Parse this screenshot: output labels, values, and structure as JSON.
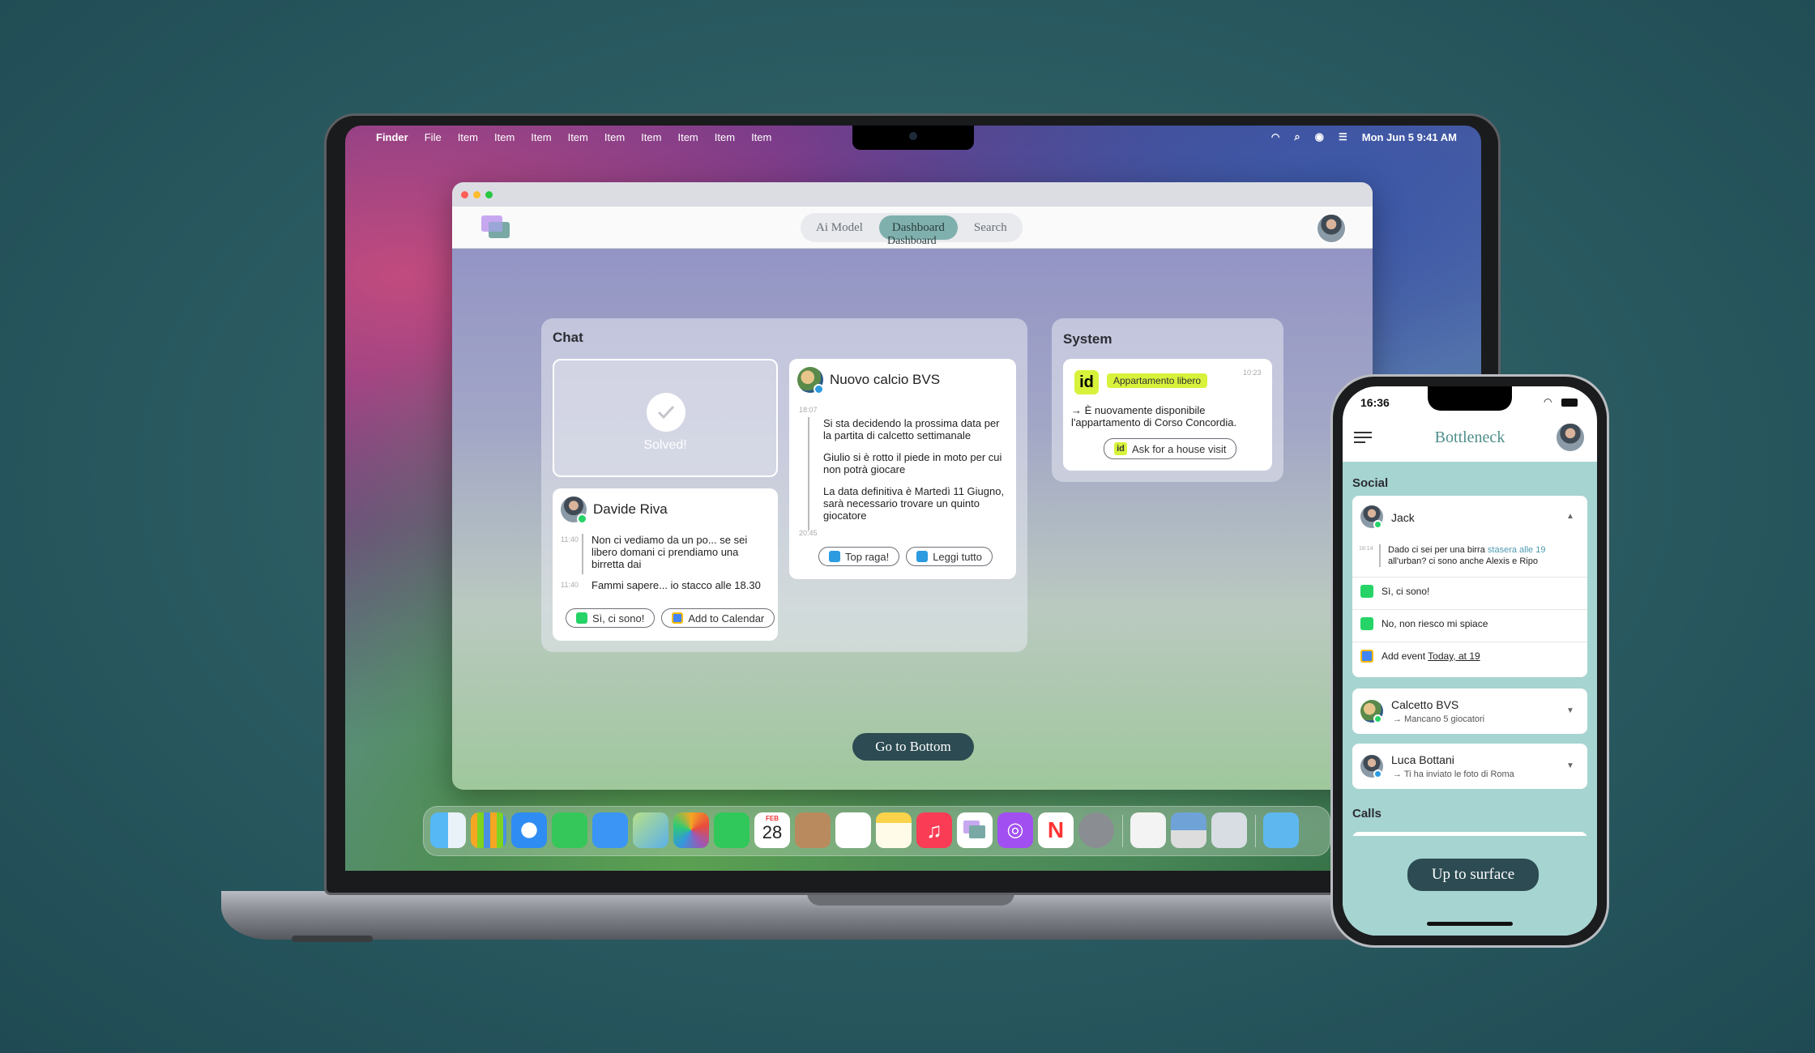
{
  "mac": {
    "menubar": {
      "apple": "",
      "app": "Finder",
      "items": [
        "File",
        "Item",
        "Item",
        "Item",
        "Item",
        "Item",
        "Item",
        "Item",
        "Item",
        "Item"
      ],
      "datetime": "Mon Jun 5  9:41 AM"
    },
    "app": {
      "nav": [
        "Ai Model",
        "Dashboard",
        "Search"
      ],
      "nav_sub": "Dashboard",
      "chat": {
        "title": "Chat",
        "solved": "Solved!",
        "davide": {
          "name": "Davide Riva",
          "m1_time": "11:40",
          "m1": "Non ci vediamo da un po... se sei libero domani ci prendiamo una birretta dai",
          "m2_time": "11:40",
          "m2": "Fammi sapere... io stacco alle 18.30",
          "btn1": "Sì, ci sono!",
          "btn2": "Add to Calendar"
        },
        "nuovo": {
          "name": "Nuovo calcio BVS",
          "t1": "18:07",
          "m1": "Si sta decidendo la prossima data per la partita di calcetto settimanale",
          "m2": "Giulio si è rotto il piede in moto per cui non potrà giocare",
          "m3": "La data definitiva è Martedì 11 Giugno, sarà necessario trovare un quinto giocatore",
          "t2": "20:45",
          "btn1": "Top raga!",
          "btn2": "Leggi tutto"
        }
      },
      "system": {
        "title": "System",
        "logo": "id",
        "tag": "Appartamento libero",
        "time": "10:23",
        "msg": "→ È nuovamente disponibile l'appartamento di Corso Concordia.",
        "btn_icon": "id",
        "btn": "Ask for a house visit"
      },
      "go_bottom": "Go to Bottom"
    },
    "dock": {
      "calendar_month": "FEB",
      "calendar_day": "28"
    }
  },
  "phone": {
    "time": "16:36",
    "title": "Bottleneck",
    "social": "Social",
    "jack": {
      "name": "Jack",
      "time": "18:14",
      "msg_a": "Dado ci sei per una birra ",
      "msg_link": "stasera alle 19",
      "msg_b": " all'urban? ci sono anche Alexis e Ripo",
      "opt1": "Sì, ci sono!",
      "opt2": "No, non riesco mi spiace",
      "opt3_a": "Add event ",
      "opt3_b": "Today, at 19"
    },
    "calcetto": {
      "name": "Calcetto BVS",
      "sub": "→ Mancano 5 giocatori"
    },
    "luca": {
      "name": "Luca Bottani",
      "sub": "→ Ti ha inviato le foto di Roma"
    },
    "calls": "Calls",
    "up": "Up to surface"
  },
  "colors": {
    "accent": "#7fb0ad",
    "dark_pill": "#2c4b52",
    "tag": "#d8f23b"
  }
}
